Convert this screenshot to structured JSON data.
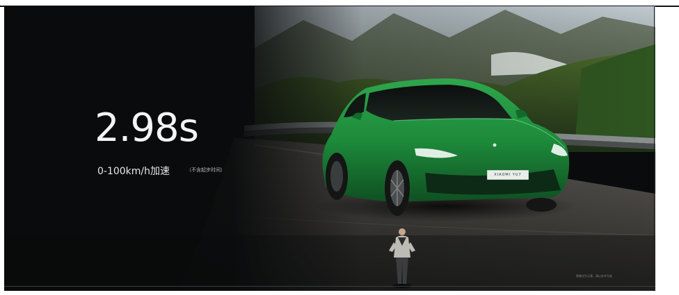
{
  "slide": {
    "metric": "2.98s",
    "caption": "0-100km/h加速",
    "note": "（不含起步时间）",
    "car_badge": "XIAOMI YU7",
    "disclaimer": "图像仅为示意，请以实车为准"
  },
  "colors": {
    "background": "#0a0b0c",
    "car_body": "#1d8a3a",
    "text_primary": "#f4f4f4"
  }
}
